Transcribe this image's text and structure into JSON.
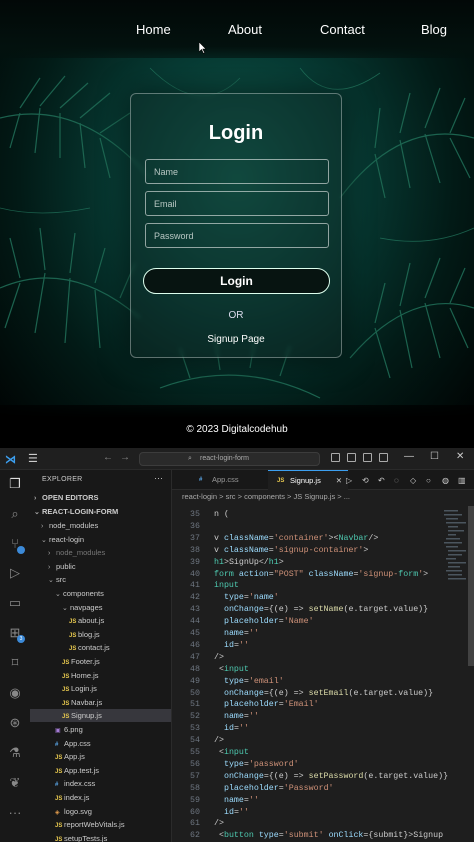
{
  "site": {
    "nav": [
      "Home",
      "About",
      "Contact",
      "Blog"
    ],
    "form_title": "Login",
    "fields": [
      {
        "placeholder": "Name"
      },
      {
        "placeholder": "Email"
      },
      {
        "placeholder": "Password"
      }
    ],
    "login_button": "Login",
    "or_text": "OR",
    "signup_link": "Signup Page",
    "footer": "© 2023 Digitalcodehub"
  },
  "vscode": {
    "search_box": "react-login-form",
    "explorer_title": "EXPLORER",
    "open_editors": "OPEN EDITORS",
    "project": "REACT-LOGIN-FORM",
    "tree": [
      {
        "label": "node_modules",
        "kind": "folder",
        "depth": 1
      },
      {
        "label": "react-login",
        "kind": "folder-open",
        "depth": 1
      },
      {
        "label": "node_modules",
        "kind": "folder",
        "depth": 2,
        "dim": true
      },
      {
        "label": "public",
        "kind": "folder",
        "depth": 2
      },
      {
        "label": "src",
        "kind": "folder-open",
        "depth": 2
      },
      {
        "label": "components",
        "kind": "folder-open",
        "depth": 3
      },
      {
        "label": "navpages",
        "kind": "folder-open",
        "depth": 4
      },
      {
        "label": "about.js",
        "kind": "js",
        "depth": 5
      },
      {
        "label": "blog.js",
        "kind": "js",
        "depth": 5
      },
      {
        "label": "contact.js",
        "kind": "js",
        "depth": 5
      },
      {
        "label": "Footer.js",
        "kind": "js",
        "depth": 4
      },
      {
        "label": "Home.js",
        "kind": "js",
        "depth": 4
      },
      {
        "label": "Login.js",
        "kind": "js",
        "depth": 4
      },
      {
        "label": "Navbar.js",
        "kind": "js",
        "depth": 4
      },
      {
        "label": "Signup.js",
        "kind": "js",
        "depth": 4,
        "selected": true
      },
      {
        "label": "6.png",
        "kind": "img",
        "depth": 3
      },
      {
        "label": "App.css",
        "kind": "css",
        "depth": 3
      },
      {
        "label": "App.js",
        "kind": "js",
        "depth": 3
      },
      {
        "label": "App.test.js",
        "kind": "js",
        "depth": 3
      },
      {
        "label": "index.css",
        "kind": "css",
        "depth": 3
      },
      {
        "label": "index.js",
        "kind": "js",
        "depth": 3
      },
      {
        "label": "logo.svg",
        "kind": "svg",
        "depth": 3
      },
      {
        "label": "reportWebVitals.js",
        "kind": "js",
        "depth": 3
      },
      {
        "label": "setupTests.js",
        "kind": "js",
        "depth": 3
      }
    ],
    "tabs": [
      {
        "label": "App.css",
        "icon": "#",
        "active": false
      },
      {
        "label": "Signup.js",
        "icon": "JS",
        "active": true
      }
    ],
    "breadcrumb": "react-login  >  src  >  components  >  JS Signup.js  > ...",
    "line_numbers": [
      "35",
      "36",
      "37",
      "38",
      "39",
      "40",
      "41",
      "42",
      "43",
      "44",
      "45",
      "46",
      "47",
      "48",
      "49",
      "50",
      "51",
      "52",
      "53",
      "54",
      "55",
      "56",
      "57",
      "58",
      "59",
      "60",
      "61",
      "62"
    ],
    "code_lines": [
      "n (",
      "",
      "v className='container'><Navbar/>",
      "v className='signup-container'>",
      "h1>SignUp</h1>",
      "form action=\"POST\" className='signup-form'>",
      "input",
      "  type='name'",
      "  onChange={(e) => setName(e.target.value)}",
      "  placeholder='Name'",
      "  name=''",
      "  id=''",
      "/>",
      " <input",
      "  type='email'",
      "  onChange={(e) => setEmail(e.target.value)}",
      "  placeholder='Email'",
      "  name=''",
      "  id=''",
      "/>",
      " <input",
      "  type='password'",
      "  onChange={(e) => setPassword(e.target.value)}",
      "  placeholder='Password'",
      "  name=''",
      "  id=''",
      "/>",
      " <button type='submit' onClick={submit}>Signup"
    ]
  }
}
